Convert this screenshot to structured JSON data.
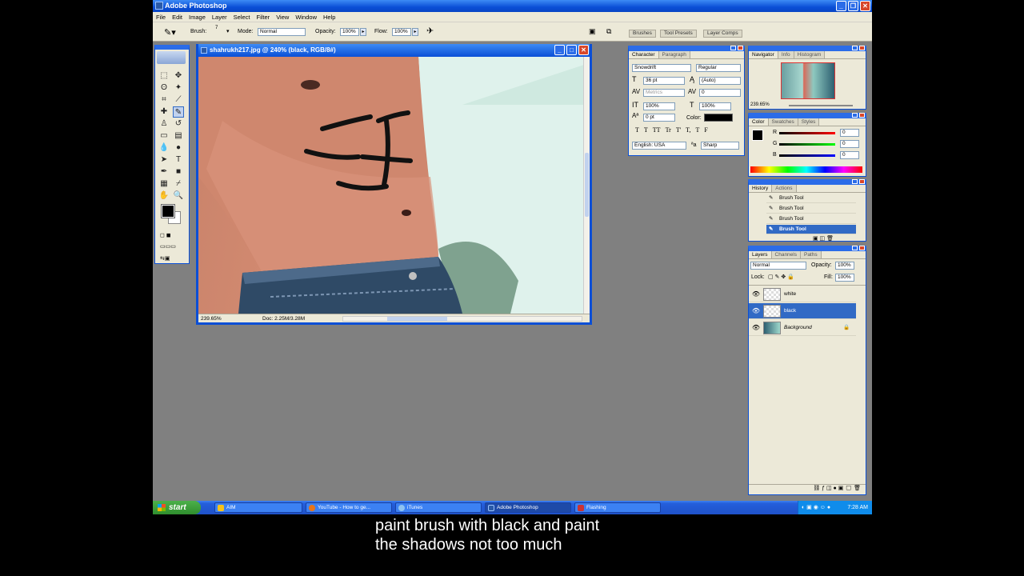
{
  "app": {
    "title": "Adobe Photoshop"
  },
  "menu": [
    "File",
    "Edit",
    "Image",
    "Layer",
    "Select",
    "Filter",
    "View",
    "Window",
    "Help"
  ],
  "options": {
    "brush_label": "Brush:",
    "brush_size": "7",
    "mode_label": "Mode:",
    "mode_value": "Normal",
    "opacity_label": "Opacity:",
    "opacity_value": "100%",
    "flow_label": "Flow:",
    "flow_value": "100%",
    "well_tabs": [
      "Brushes",
      "Tool Presets",
      "Layer Comps"
    ]
  },
  "document": {
    "title": "shahrukh217.jpg @ 240% (black, RGB/8#)",
    "zoom": "239.65%",
    "doc_size": "Doc: 2.25M/3.28M"
  },
  "character": {
    "tabs": [
      "Character",
      "Paragraph"
    ],
    "font": "Snowdrift",
    "style": "Regular",
    "size": "36 pt",
    "leading": "(Auto)",
    "kerning": "Metrics",
    "tracking": "0",
    "vscale": "100%",
    "hscale": "100%",
    "baseline": "0 pt",
    "color_label": "Color:",
    "language": "English: USA",
    "antialias": "Sharp",
    "styles": [
      "T",
      "T",
      "TT",
      "Tr",
      "T'",
      "T,",
      "T",
      "F"
    ]
  },
  "navigator": {
    "tabs": [
      "Navigator",
      "Info",
      "Histogram"
    ],
    "zoom": "239.65%"
  },
  "color_panel": {
    "tabs": [
      "Color",
      "Swatches",
      "Styles"
    ],
    "channels": [
      {
        "label": "R",
        "value": "0"
      },
      {
        "label": "G",
        "value": "0"
      },
      {
        "label": "B",
        "value": "0"
      }
    ]
  },
  "history": {
    "tabs": [
      "History",
      "Actions"
    ],
    "items": [
      "Brush Tool",
      "Brush Tool",
      "Brush Tool",
      "Brush Tool"
    ]
  },
  "layers": {
    "tabs": [
      "Layers",
      "Channels",
      "Paths"
    ],
    "blend_mode": "Normal",
    "opacity_label": "Opacity:",
    "opacity": "100%",
    "lock_label": "Lock:",
    "fill_label": "Fill:",
    "fill": "100%",
    "items": [
      {
        "name": "white"
      },
      {
        "name": "black"
      },
      {
        "name": "Background"
      }
    ]
  },
  "taskbar": {
    "start": "start",
    "items": [
      "AIM",
      "YouTube - How to ge...",
      "iTunes",
      "Adobe Photoshop",
      "Flashing"
    ],
    "clock": "7:28 AM"
  },
  "caption": {
    "line1": "paint brush with black and paint",
    "line2": "the shadows not too much"
  }
}
